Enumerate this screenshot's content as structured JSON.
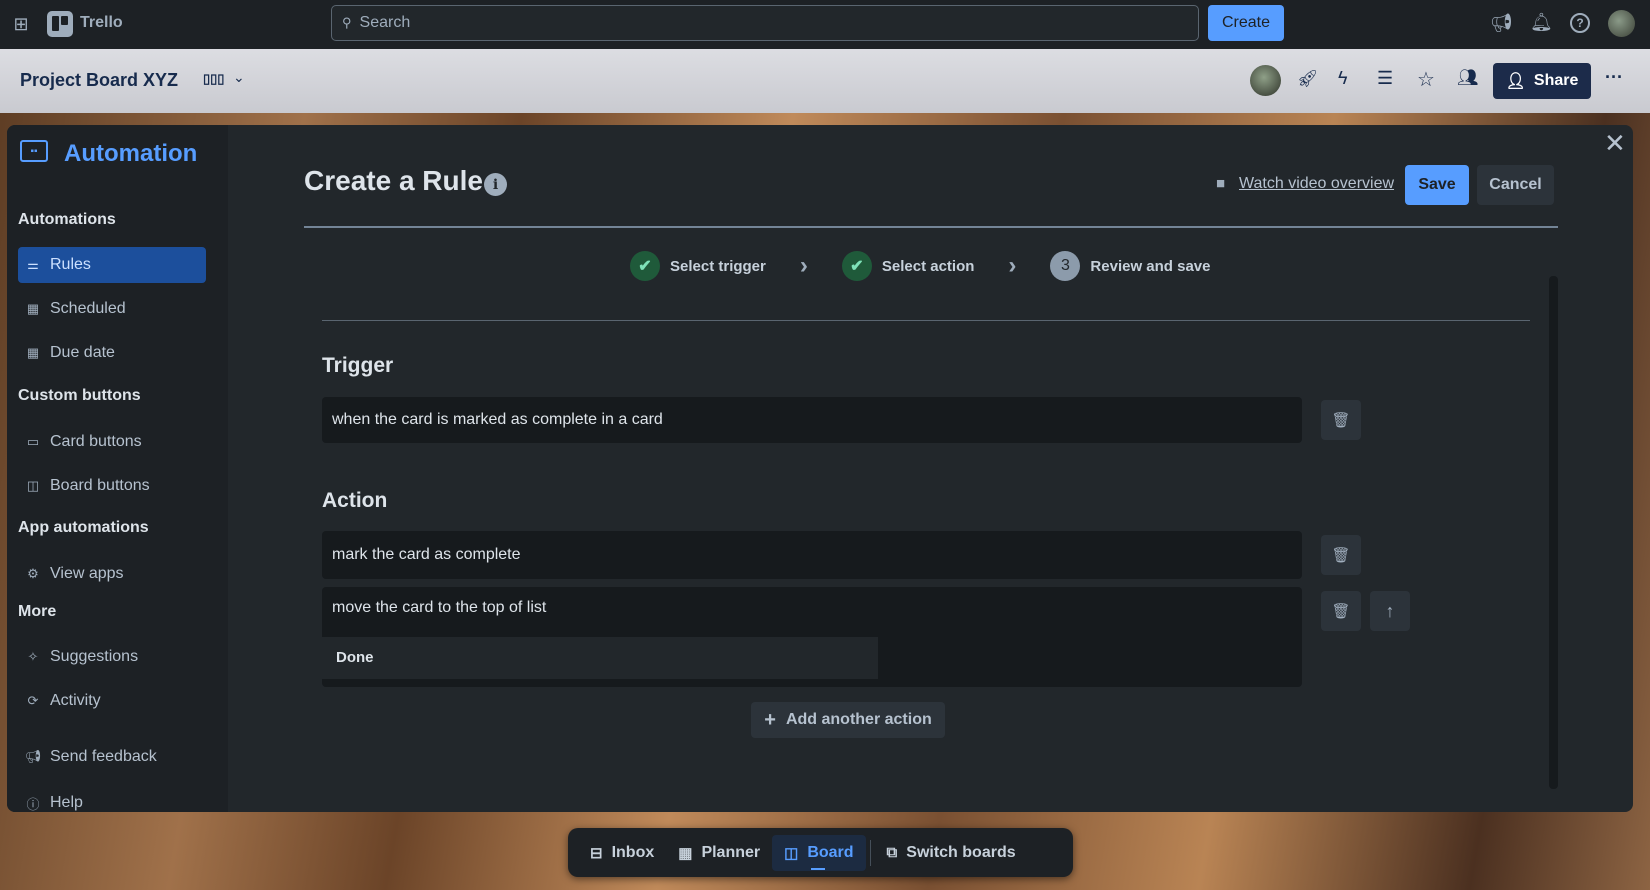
{
  "topbar": {
    "app_name": "Trello",
    "search_placeholder": "Search",
    "create_label": "Create"
  },
  "board": {
    "title": "Project Board XYZ",
    "share_label": "Share"
  },
  "sidebar": {
    "title": "Automation",
    "sections": [
      {
        "heading": "Automations",
        "items": [
          "Rules",
          "Scheduled",
          "Due date"
        ]
      },
      {
        "heading": "Custom buttons",
        "items": [
          "Card buttons",
          "Board buttons"
        ]
      },
      {
        "heading": "App automations",
        "items": [
          "View apps"
        ]
      },
      {
        "heading": "More",
        "items": [
          "Suggestions",
          "Activity",
          "Send feedback",
          "Help"
        ]
      }
    ]
  },
  "rule": {
    "title": "Create a Rule",
    "watch_video": "Watch video overview",
    "save_label": "Save",
    "cancel_label": "Cancel",
    "steps": [
      {
        "label": "Select trigger",
        "state": "done"
      },
      {
        "label": "Select action",
        "state": "done"
      },
      {
        "label": "Review and save",
        "number": "3",
        "state": "current"
      }
    ],
    "trigger_heading": "Trigger",
    "trigger_text": "when the card is marked as complete in a card",
    "action_heading": "Action",
    "actions": [
      "mark the card as complete",
      "move the card to the top of list"
    ],
    "action_list_value": "Done",
    "add_action_label": "Add another action"
  },
  "dock": {
    "items": [
      "Inbox",
      "Planner",
      "Board",
      "Switch boards"
    ],
    "active": "Board"
  },
  "colors": {
    "accent": "#579dff",
    "topbar": "#1d2125",
    "modal": "#22272b",
    "share": "#1c2b4a"
  }
}
